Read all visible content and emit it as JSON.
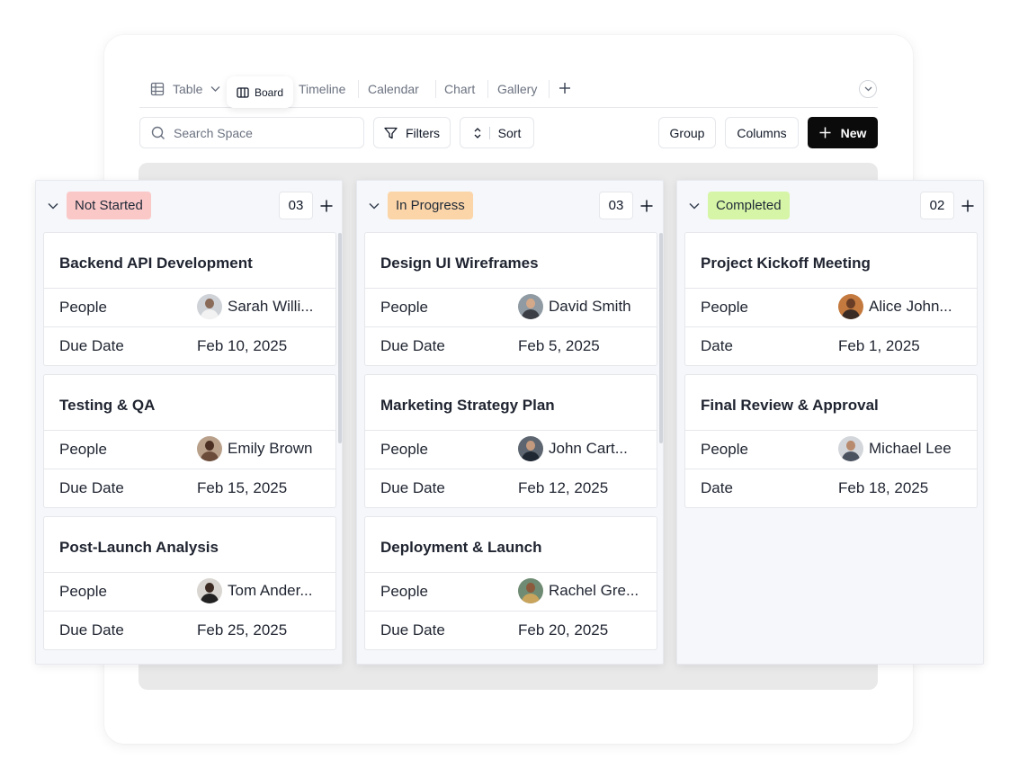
{
  "tabs": [
    {
      "label": "Table",
      "icon": "table-icon"
    },
    {
      "label": "Board",
      "icon": "board-icon",
      "active": true
    },
    {
      "label": "Timeline"
    },
    {
      "label": "Calendar"
    },
    {
      "label": "Chart"
    },
    {
      "label": "Gallery"
    }
  ],
  "toolbar": {
    "search_placeholder": "Search Space",
    "filters_label": "Filters",
    "sort_label": "Sort",
    "group_label": "Group",
    "columns_label": "Columns",
    "new_label": "New"
  },
  "columns": [
    {
      "status": "Not Started",
      "count": "03",
      "badge_color": "#fbc8c8",
      "cards": [
        {
          "title": "Backend API Development",
          "people_label": "People",
          "person": "Sarah Willi...",
          "date_label": "Due Date",
          "date": "Feb 10, 2025"
        },
        {
          "title": "Testing & QA",
          "people_label": "People",
          "person": "Emily Brown",
          "date_label": "Due Date",
          "date": "Feb 15, 2025"
        },
        {
          "title": "Post-Launch Analysis",
          "people_label": "People",
          "person": "Tom Ander...",
          "date_label": "Due Date",
          "date": "Feb 25, 2025"
        }
      ]
    },
    {
      "status": "In Progress",
      "count": "03",
      "badge_color": "#fbd5a8",
      "cards": [
        {
          "title": "Design UI Wireframes",
          "people_label": "People",
          "person": "David Smith",
          "date_label": "Due Date",
          "date": "Feb 5, 2025"
        },
        {
          "title": "Marketing Strategy Plan",
          "people_label": "People",
          "person": "John Cart...",
          "date_label": "Due Date",
          "date": "Feb 12, 2025"
        },
        {
          "title": "Deployment & Launch",
          "people_label": "People",
          "person": "Rachel Gre...",
          "date_label": "Due Date",
          "date": "Feb 20, 2025"
        }
      ]
    },
    {
      "status": "Completed",
      "count": "02",
      "badge_color": "#d6f5a6",
      "cards": [
        {
          "title": "Project Kickoff Meeting",
          "people_label": "People",
          "person": "Alice John...",
          "date_label": "Date",
          "date": "Feb 1, 2025"
        },
        {
          "title": "Final Review & Approval",
          "people_label": "People",
          "person": "Michael Lee",
          "date_label": "Date",
          "date": "Feb 18, 2025"
        }
      ]
    }
  ]
}
